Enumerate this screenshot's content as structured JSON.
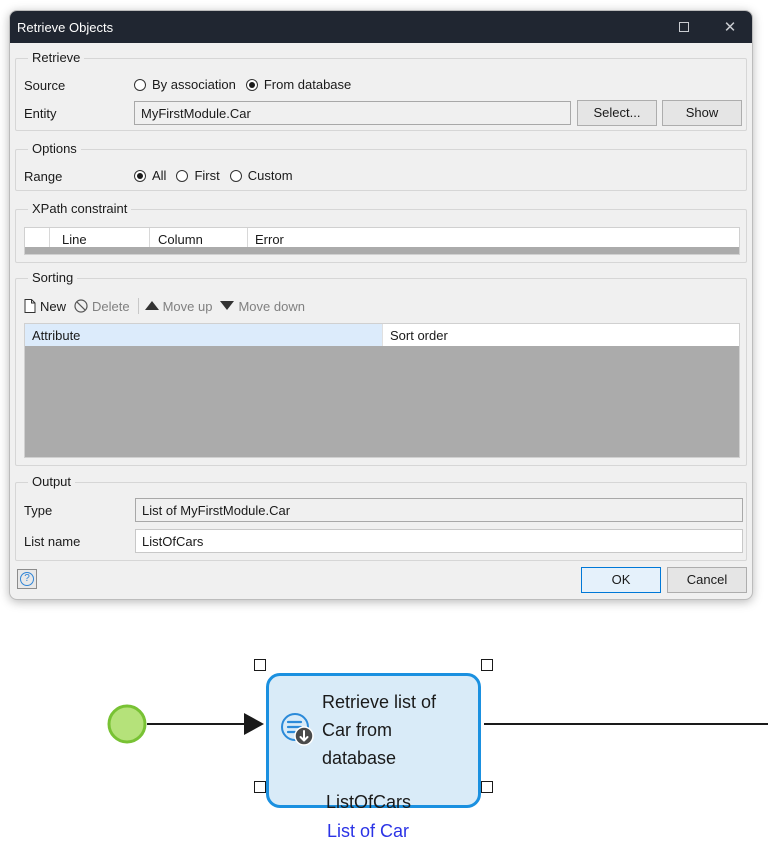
{
  "dialog": {
    "title": "Retrieve Objects",
    "retrieve": {
      "legend": "Retrieve",
      "source_label": "Source",
      "source_options": [
        "By association",
        "From database"
      ],
      "source_selected": "From database",
      "entity_label": "Entity",
      "entity_value": "MyFirstModule.Car",
      "select_button": "Select...",
      "show_button": "Show"
    },
    "options": {
      "legend": "Options",
      "range_label": "Range",
      "range_options": [
        "All",
        "First",
        "Custom"
      ],
      "range_selected": "All"
    },
    "xpath": {
      "legend": "XPath constraint",
      "columns": [
        "Line",
        "Column",
        "Error"
      ]
    },
    "sorting": {
      "legend": "Sorting",
      "toolbar": {
        "new": "New",
        "delete": "Delete",
        "move_up": "Move up",
        "move_down": "Move down"
      },
      "columns": [
        "Attribute",
        "Sort order"
      ]
    },
    "output": {
      "legend": "Output",
      "type_label": "Type",
      "type_value": "List of MyFirstModule.Car",
      "list_name_label": "List name",
      "list_name_value": "ListOfCars"
    },
    "ok_button": "OK",
    "cancel_button": "Cancel",
    "help_icon": "question-icon"
  },
  "microflow": {
    "activity_lines": [
      "Retrieve list of",
      "Car from",
      "database"
    ],
    "output_variable": "ListOfCars",
    "output_type": "List of Car",
    "colors": {
      "activity_border": "#1a90e0",
      "activity_fill": "#d9ebf8",
      "start_event_fill": "#b5e27a",
      "start_event_border": "#78c234",
      "type_text": "#2b33e6"
    }
  }
}
